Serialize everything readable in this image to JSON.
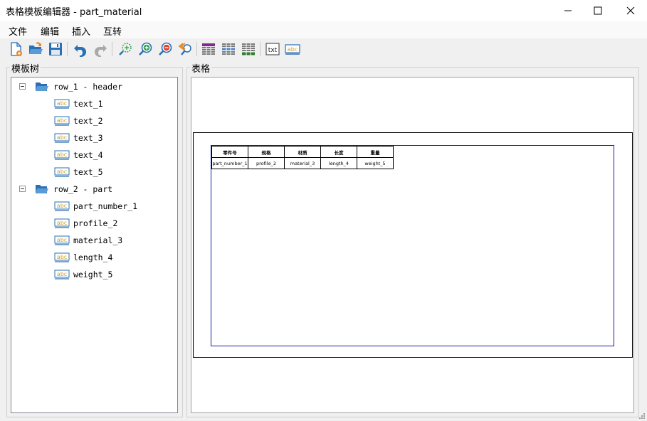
{
  "window": {
    "title": "表格模板编辑器 - part_material"
  },
  "menu": {
    "file": "文件",
    "edit": "编辑",
    "insert": "插入",
    "convert": "互转"
  },
  "toolbar": {
    "txt_label": "txt",
    "abc_label": "abc"
  },
  "panels": {
    "tree_title": "模板树",
    "table_title": "表格"
  },
  "tree": {
    "rows": [
      {
        "label": "row_1 - header",
        "children": [
          "text_1",
          "text_2",
          "text_3",
          "text_4",
          "text_5"
        ]
      },
      {
        "label": "row_2 - part",
        "children": [
          "part_number_1",
          "profile_2",
          "material_3",
          "length_4",
          "weight_5"
        ]
      }
    ],
    "icon_text": "abc"
  },
  "table": {
    "header": [
      "零件号",
      "规格",
      "材质",
      "长度",
      "重量"
    ],
    "data": [
      "part_number_1",
      "profile_2",
      "material_3",
      "length_4",
      "weight_5"
    ]
  }
}
